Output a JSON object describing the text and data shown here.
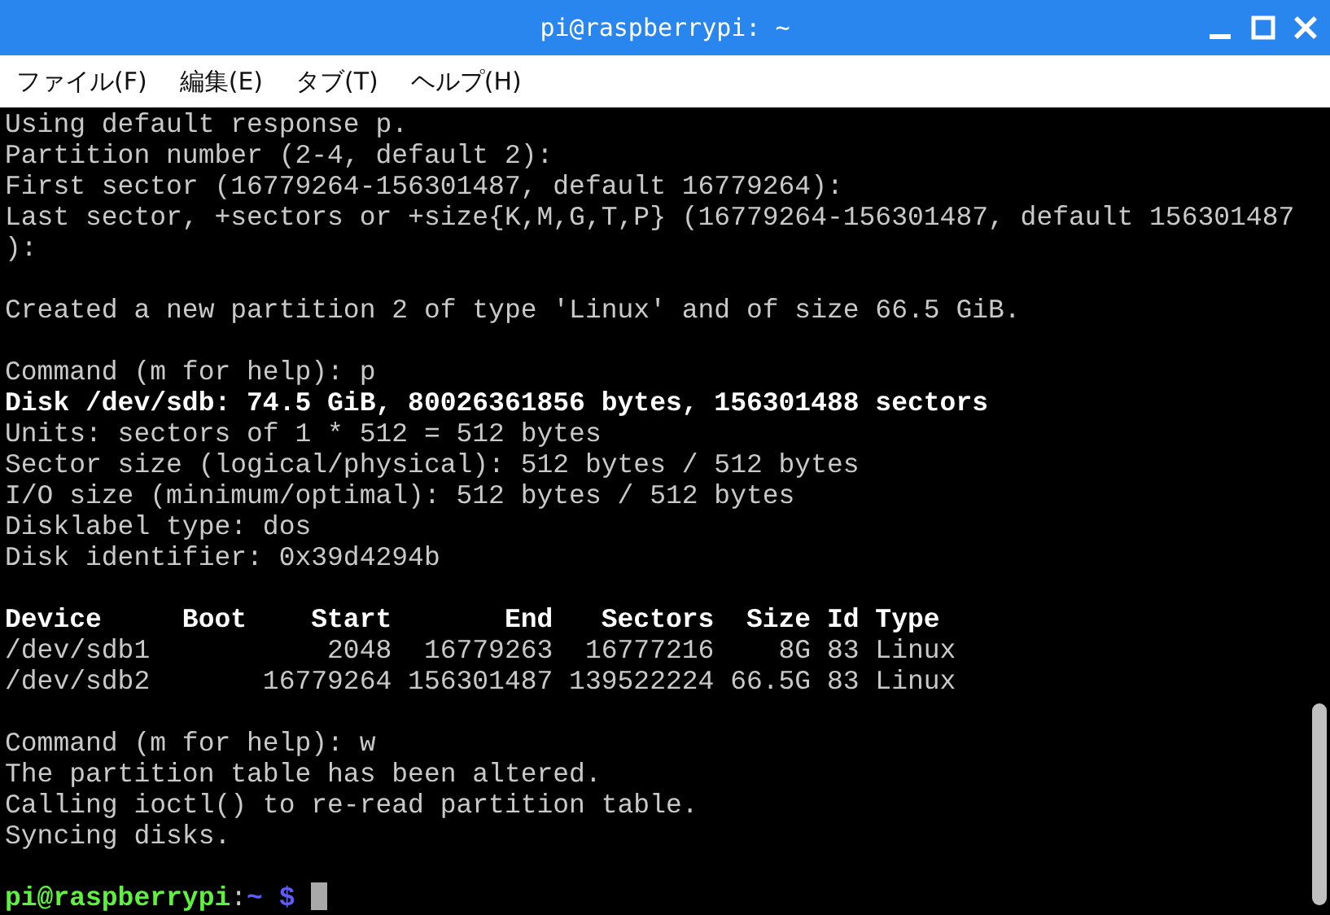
{
  "window": {
    "title": "pi@raspberrypi: ~"
  },
  "menu": [
    "ファイル(F)",
    "編集(E)",
    "タブ(T)",
    "ヘルプ(H)"
  ],
  "terminal": {
    "lines": [
      {
        "kind": "normal",
        "text": "Using default response p."
      },
      {
        "kind": "normal",
        "text": "Partition number (2-4, default 2):"
      },
      {
        "kind": "normal",
        "text": "First sector (16779264-156301487, default 16779264):"
      },
      {
        "kind": "normal",
        "text": "Last sector, +sectors or +size{K,M,G,T,P} (16779264-156301487, default 156301487"
      },
      {
        "kind": "normal",
        "text": "):"
      },
      {
        "kind": "blank"
      },
      {
        "kind": "normal",
        "text": "Created a new partition 2 of type 'Linux' and of size 66.5 GiB."
      },
      {
        "kind": "blank"
      },
      {
        "kind": "normal",
        "text": "Command (m for help): p"
      },
      {
        "kind": "bold",
        "text": "Disk /dev/sdb: 74.5 GiB, 80026361856 bytes, 156301488 sectors"
      },
      {
        "kind": "normal",
        "text": "Units: sectors of 1 * 512 = 512 bytes"
      },
      {
        "kind": "normal",
        "text": "Sector size (logical/physical): 512 bytes / 512 bytes"
      },
      {
        "kind": "normal",
        "text": "I/O size (minimum/optimal): 512 bytes / 512 bytes"
      },
      {
        "kind": "normal",
        "text": "Disklabel type: dos"
      },
      {
        "kind": "normal",
        "text": "Disk identifier: 0x39d4294b"
      },
      {
        "kind": "blank"
      },
      {
        "kind": "bold",
        "text": "Device     Boot    Start       End   Sectors  Size Id Type"
      },
      {
        "kind": "normal",
        "text": "/dev/sdb1           2048  16779263  16777216    8G 83 Linux"
      },
      {
        "kind": "normal",
        "text": "/dev/sdb2       16779264 156301487 139522224 66.5G 83 Linux"
      },
      {
        "kind": "blank"
      },
      {
        "kind": "normal",
        "text": "Command (m for help): w"
      },
      {
        "kind": "normal",
        "text": "The partition table has been altered."
      },
      {
        "kind": "normal",
        "text": "Calling ioctl() to re-read partition table."
      },
      {
        "kind": "normal",
        "text": "Syncing disks."
      },
      {
        "kind": "blank"
      }
    ],
    "prompt": {
      "user": "pi@raspberrypi",
      "separator": ":",
      "path": "~",
      "symbol": "$"
    }
  }
}
